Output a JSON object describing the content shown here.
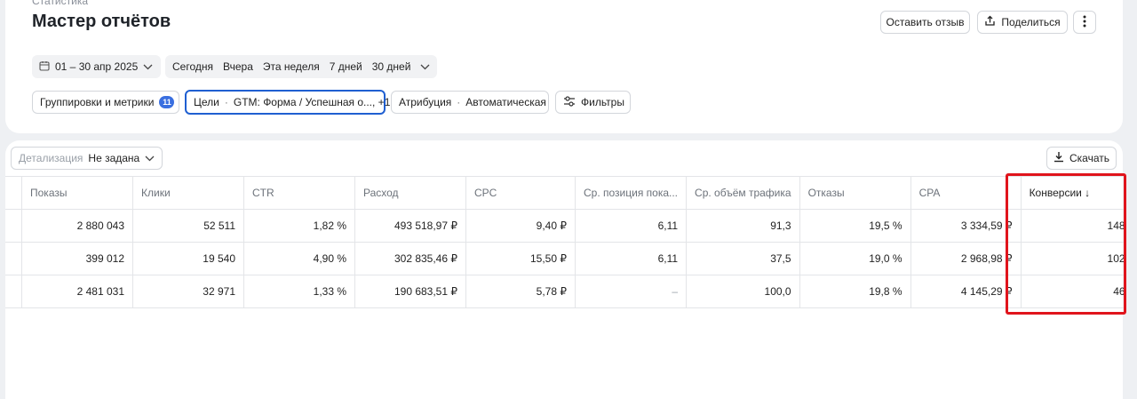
{
  "header": {
    "breadcrumb": "Статистика",
    "title": "Мастер отчётов",
    "feedback_label": "Оставить отзыв",
    "share_label": "Поделиться"
  },
  "period": {
    "range": "01 – 30 апр 2025",
    "quick": [
      "Сегодня",
      "Вчера",
      "Эта неделя",
      "7 дней",
      "30 дней"
    ]
  },
  "params": {
    "groupings_label": "Группировки и метрики",
    "groupings_count": "11",
    "goals_label": "Цели",
    "goals_value": "GTM: Форма / Успешная о..., +1",
    "attribution_label": "Атрибуция",
    "attribution_value": "Автоматическая",
    "filters_label": "Фильтры",
    "separator": "·"
  },
  "toolbar": {
    "detail_label": "Детализация",
    "detail_value": "Не задана",
    "download_label": "Скачать"
  },
  "table": {
    "columns": [
      "Показы",
      "Клики",
      "CTR",
      "Расход",
      "CPC",
      "Ср. позиция пока...",
      "Ср. объём трафика",
      "Отказы",
      "CPA",
      "Конверсии ↓"
    ],
    "rows": [
      [
        "2 880 043",
        "52 511",
        "1,82 %",
        "493 518,97 ₽",
        "9,40 ₽",
        "6,11",
        "91,3",
        "19,5 %",
        "3 334,59 ₽",
        "148"
      ],
      [
        "399 012",
        "19 540",
        "4,90 %",
        "302 835,46 ₽",
        "15,50 ₽",
        "6,11",
        "37,5",
        "19,0 %",
        "2 968,98 ₽",
        "102"
      ],
      [
        "2 481 031",
        "32 971",
        "1,33 %",
        "190 683,51 ₽",
        "5,78 ₽",
        "–",
        "100,0",
        "19,8 %",
        "4 145,29 ₽",
        "46"
      ]
    ]
  },
  "colors": {
    "accent": "#1f5fd1",
    "badge": "#3a6fe0",
    "highlight": "#e0141c"
  },
  "icons": [
    "calendar-icon",
    "chevron-down-icon",
    "share-icon",
    "more-vertical-icon",
    "filter-sliders-icon",
    "download-icon"
  ]
}
